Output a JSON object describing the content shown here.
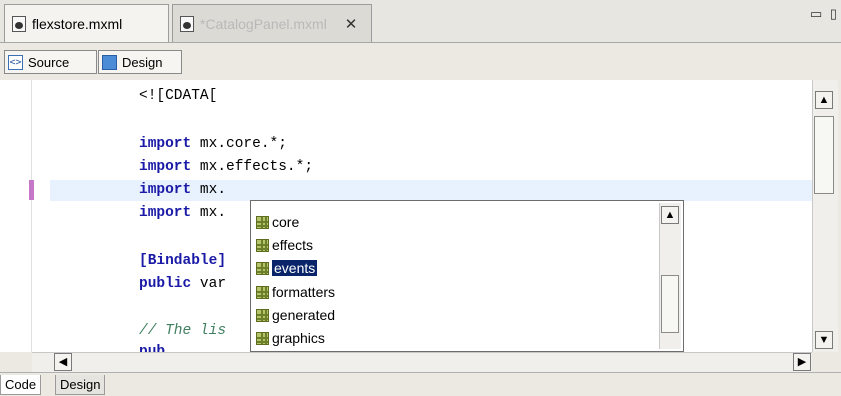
{
  "tabs": [
    {
      "label": "flexstore.mxml",
      "active": false
    },
    {
      "label": "*CatalogPanel.mxml",
      "active": true
    }
  ],
  "tab_close_glyph": "✕",
  "window_buttons": "▭ ▯",
  "mode_buttons": {
    "source": "Source",
    "design": "Design",
    "source_icon": "<>",
    "design_icon": "▦"
  },
  "code_lines": [
    {
      "kw": "",
      "text": "<![CDATA["
    },
    {
      "kw": "import",
      "text": " mx.core.*;"
    },
    {
      "kw": "import",
      "text": " mx.effects.*;"
    },
    {
      "kw": "import",
      "text": " mx."
    },
    {
      "kw": "import",
      "text": " mx."
    },
    {
      "kw": "[Bindable]",
      "text": ""
    },
    {
      "kw": "public",
      "text": " var"
    },
    {
      "comment": "// The lis"
    },
    {
      "comment": "pub"
    }
  ],
  "autocomplete": {
    "items": [
      "core",
      "effects",
      "events",
      "formatters",
      "generated",
      "graphics"
    ],
    "selected": "events"
  },
  "bottom_tabs": {
    "code": "Code",
    "design": "Design"
  },
  "scroll_glyphs": {
    "up": "▲",
    "down": "▼",
    "left": "◀",
    "right": "▶"
  },
  "colors": {
    "keyword": "#1a1aa6",
    "comment": "#3f7f5f",
    "selection": "#0a246a",
    "current_line": "#e8f2fe",
    "marker": "#c678c6"
  }
}
